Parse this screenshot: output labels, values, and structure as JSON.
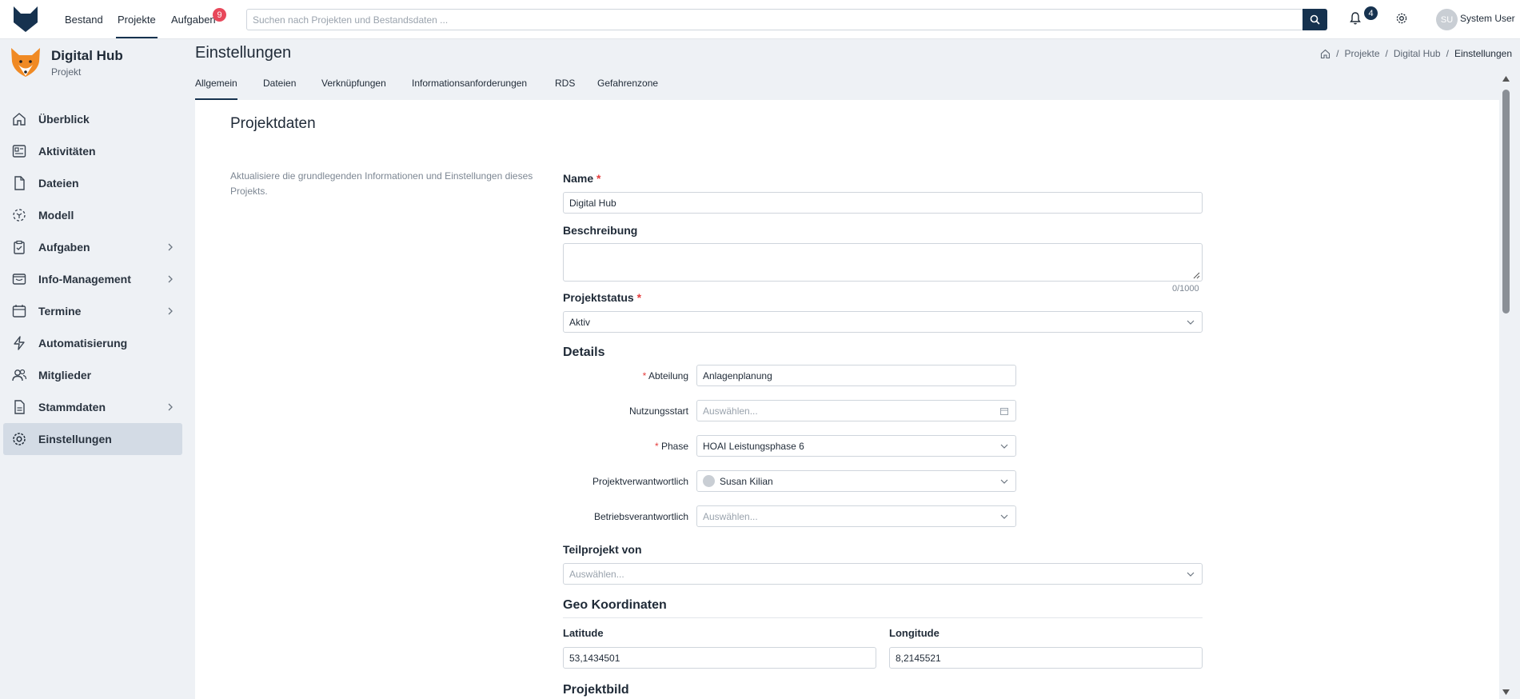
{
  "topbar": {
    "nav": [
      "Bestand",
      "Projekte",
      "Aufgaben"
    ],
    "tasks_badge": "9",
    "search_placeholder": "Suchen nach Projekten und Bestandsdaten ...",
    "notifications_badge": "4",
    "user_initials": "SU",
    "user_name": "System User"
  },
  "sidebar": {
    "project_name": "Digital Hub",
    "project_type": "Projekt",
    "items": [
      {
        "label": "Überblick",
        "icon": "home-icon"
      },
      {
        "label": "Aktivitäten",
        "icon": "activity-icon"
      },
      {
        "label": "Dateien",
        "icon": "file-icon"
      },
      {
        "label": "Modell",
        "icon": "model-icon"
      },
      {
        "label": "Aufgaben",
        "icon": "clipboard-icon"
      },
      {
        "label": "Info-Management",
        "icon": "inbox-icon"
      },
      {
        "label": "Termine",
        "icon": "calendar-icon"
      },
      {
        "label": "Automatisierung",
        "icon": "bolt-icon"
      },
      {
        "label": "Mitglieder",
        "icon": "users-icon"
      },
      {
        "label": "Stammdaten",
        "icon": "document-icon"
      },
      {
        "label": "Einstellungen",
        "icon": "gear-icon"
      }
    ]
  },
  "header": {
    "title": "Einstellungen",
    "breadcrumb": [
      "Projekte",
      "Digital Hub",
      "Einstellungen"
    ],
    "tabs": [
      "Allgemein",
      "Dateien",
      "Verknüpfungen",
      "Informationsanforderungen",
      "RDS",
      "Gefahrenzone"
    ]
  },
  "form": {
    "section_title": "Projektdaten",
    "section_desc": "Aktualisiere die grundlegenden Informationen und Einstellungen dieses Projekts.",
    "name_label": "Name",
    "name_value": "Digital Hub",
    "desc_label": "Beschreibung",
    "desc_counter": "0/1000",
    "status_label": "Projektstatus",
    "status_value": "Aktiv",
    "details_title": "Details",
    "abteilung_label": "Abteilung",
    "abteilung_value": "Anlagenplanung",
    "nutzungsstart_label": "Nutzungsstart",
    "nutzungsstart_placeholder": "Auswählen...",
    "phase_label": "Phase",
    "phase_value": "HOAI Leistungsphase 6",
    "projektverantwortlich_label": "Projektverwantwortlich",
    "projektverantwortlich_value": "Susan Kilian",
    "betriebsverantwortlich_label": "Betriebsverantwortlich",
    "betriebsverantwortlich_placeholder": "Auswählen...",
    "teilprojekt_label": "Teilprojekt von",
    "teilprojekt_placeholder": "Auswählen...",
    "geo_title": "Geo Koordinaten",
    "latitude_label": "Latitude",
    "latitude_value": "53,1434501",
    "longitude_label": "Longitude",
    "longitude_value": "8,2145521",
    "projektbild_title": "Projektbild"
  },
  "colors": {
    "brand": "#16324f",
    "badge_red": "#e8485b",
    "active_nav": "#d3dbe5",
    "required": "#e53e3e"
  }
}
